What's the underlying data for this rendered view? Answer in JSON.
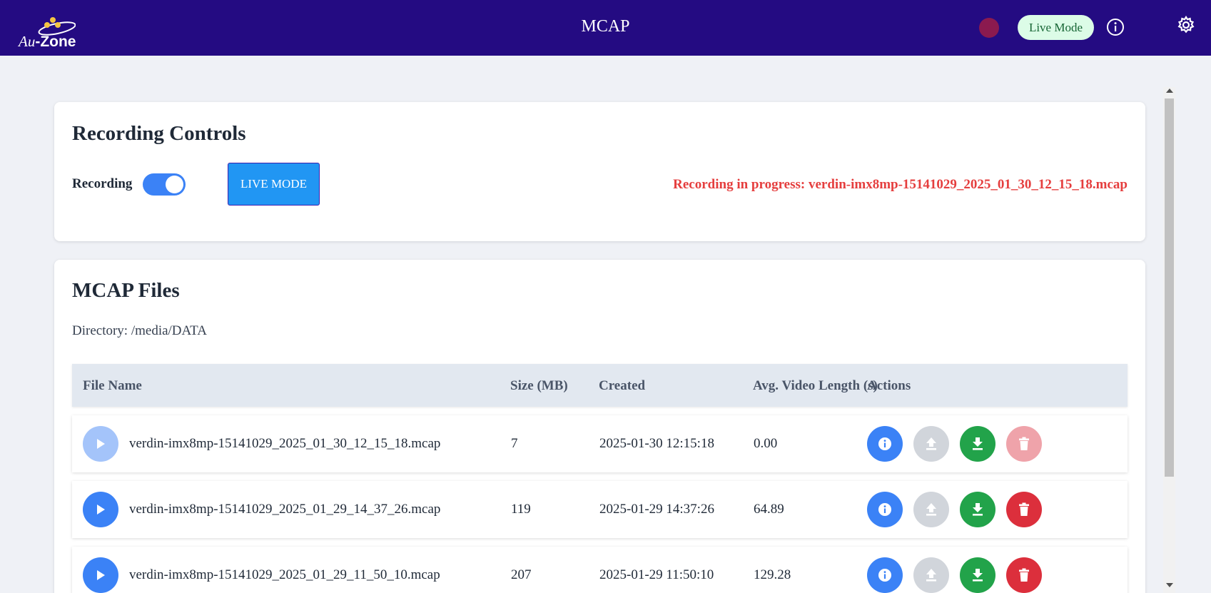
{
  "header": {
    "logo_au": "Au",
    "logo_zone": "-Zone",
    "title": "MCAP",
    "live_mode_badge": "Live Mode",
    "recording_indicator_color": "#8b1a4f",
    "icons": [
      "info-icon",
      "gear-icon"
    ]
  },
  "recording_controls": {
    "title": "Recording Controls",
    "recording_label": "Recording",
    "recording_on": true,
    "live_mode_button": "LIVE MODE",
    "status": "Recording in progress: verdin-imx8mp-15141029_2025_01_30_12_15_18.mcap"
  },
  "files": {
    "title": "MCAP Files",
    "directory": "Directory: /media/DATA",
    "columns": [
      "File Name",
      "Size (MB)",
      "Created",
      "Avg. Video Length (s)",
      "Actions"
    ],
    "rows": [
      {
        "name": "verdin-imx8mp-15141029_2025_01_30_12_15_18.mcap",
        "size": "7",
        "created": "2025-01-30 12:15:18",
        "avg": "0.00",
        "recording": true
      },
      {
        "name": "verdin-imx8mp-15141029_2025_01_29_14_37_26.mcap",
        "size": "119",
        "created": "2025-01-29 14:37:26",
        "avg": "64.89",
        "recording": false
      },
      {
        "name": "verdin-imx8mp-15141029_2025_01_29_11_50_10.mcap",
        "size": "207",
        "created": "2025-01-29 11:50:10",
        "avg": "129.28",
        "recording": false
      }
    ],
    "action_icons": [
      "info-icon",
      "upload-icon",
      "download-icon",
      "trash-icon"
    ]
  },
  "colors": {
    "header_bg": "#240b82",
    "primary": "#3b82f6",
    "success": "#22a34a",
    "danger": "#dc2f3c",
    "status_text": "#e53e3e"
  }
}
